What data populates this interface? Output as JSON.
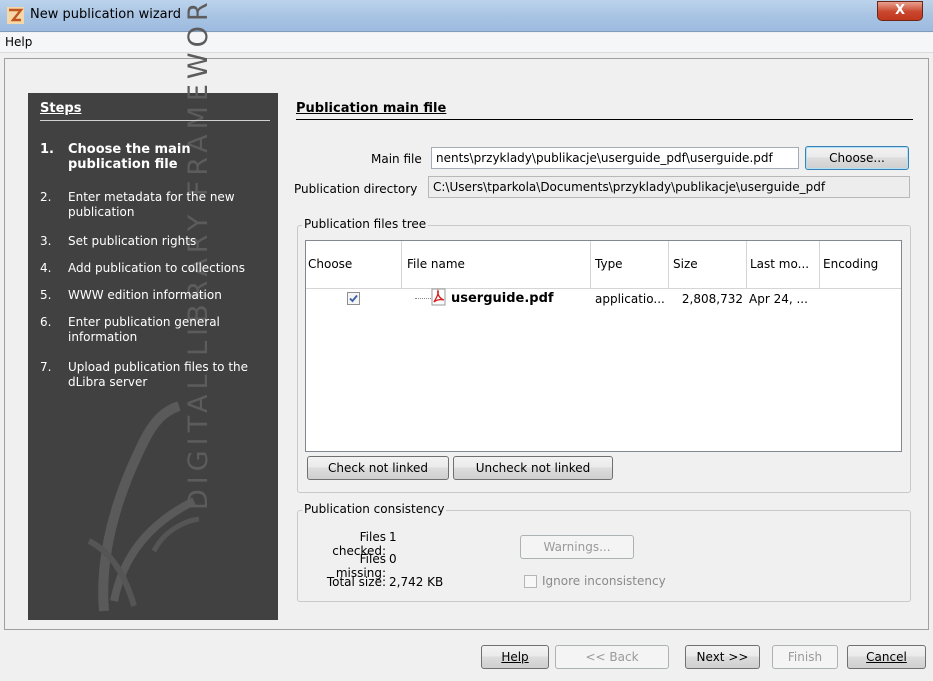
{
  "window": {
    "title": "New publication wizard",
    "close_label": "X"
  },
  "menu": {
    "help": "Help"
  },
  "steps": {
    "title": "Steps",
    "watermark": "DIGITAL LIBRARY FRAMEWORK",
    "items": [
      {
        "num": "1.",
        "label": "Choose the main publication file",
        "active": true
      },
      {
        "num": "2.",
        "label": "Enter metadata for the new publication"
      },
      {
        "num": "3.",
        "label": "Set publication rights"
      },
      {
        "num": "4.",
        "label": "Add publication to collections"
      },
      {
        "num": "5.",
        "label": "WWW edition information"
      },
      {
        "num": "6.",
        "label": "Enter publication general information"
      },
      {
        "num": "7.",
        "label": "Upload publication files to the dLibra server"
      }
    ]
  },
  "main": {
    "section_title": "Publication main file",
    "main_file_label": "Main file",
    "main_file_value": "nents\\przyklady\\publikacje\\userguide_pdf\\userguide.pdf",
    "choose_button": "Choose...",
    "pub_dir_label": "Publication directory",
    "pub_dir_value": "C:\\Users\\tparkola\\Documents\\przyklady\\publikacje\\userguide_pdf"
  },
  "files_tree": {
    "legend": "Publication files tree",
    "columns": [
      "Choose",
      "File name",
      "Type",
      "Size",
      "Last mo...",
      "Encoding"
    ],
    "rows": [
      {
        "checked": true,
        "file_name": "userguide.pdf",
        "type": "applicatio...",
        "size": "2,808,732",
        "last_modified": "Apr 24, ...",
        "encoding": ""
      }
    ],
    "check_not_linked": "Check not linked",
    "uncheck_not_linked": "Uncheck not linked"
  },
  "consistency": {
    "legend": "Publication consistency",
    "files_checked_label": "Files checked:",
    "files_checked_value": "1",
    "files_missing_label": "Files missing:",
    "files_missing_value": "0",
    "total_size_label": "Total size:",
    "total_size_value": "2,742 KB",
    "warnings_button": "Warnings...",
    "ignore_label": "Ignore inconsistency"
  },
  "footer": {
    "help": "Help",
    "back": "<< Back",
    "next": "Next >>",
    "finish": "Finish",
    "cancel": "Cancel"
  },
  "colors": {
    "steps_panel": "#414141",
    "titlebar": "#a9c4e3",
    "pdf_red": "#d42020"
  }
}
